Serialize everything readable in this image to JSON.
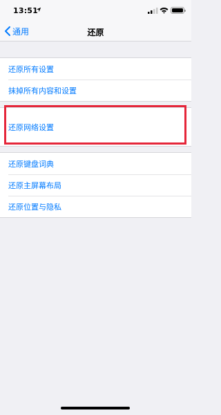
{
  "status_bar": {
    "time": "13:51"
  },
  "nav": {
    "back_label": "通用",
    "title": "还原"
  },
  "groups": [
    {
      "items": [
        "还原所有设置",
        "抹掉所有内容和设置"
      ]
    },
    {
      "items": [
        "还原网络设置"
      ]
    },
    {
      "items": [
        "还原键盘词典",
        "还原主屏幕布局",
        "还原位置与隐私"
      ]
    }
  ],
  "colors": {
    "accent": "#007aff",
    "background": "#f0f0f4",
    "highlight": "#e5263a"
  },
  "icons": [
    "location-arrow-icon",
    "signal-icon",
    "wifi-icon",
    "battery-icon",
    "chevron-left-icon"
  ]
}
